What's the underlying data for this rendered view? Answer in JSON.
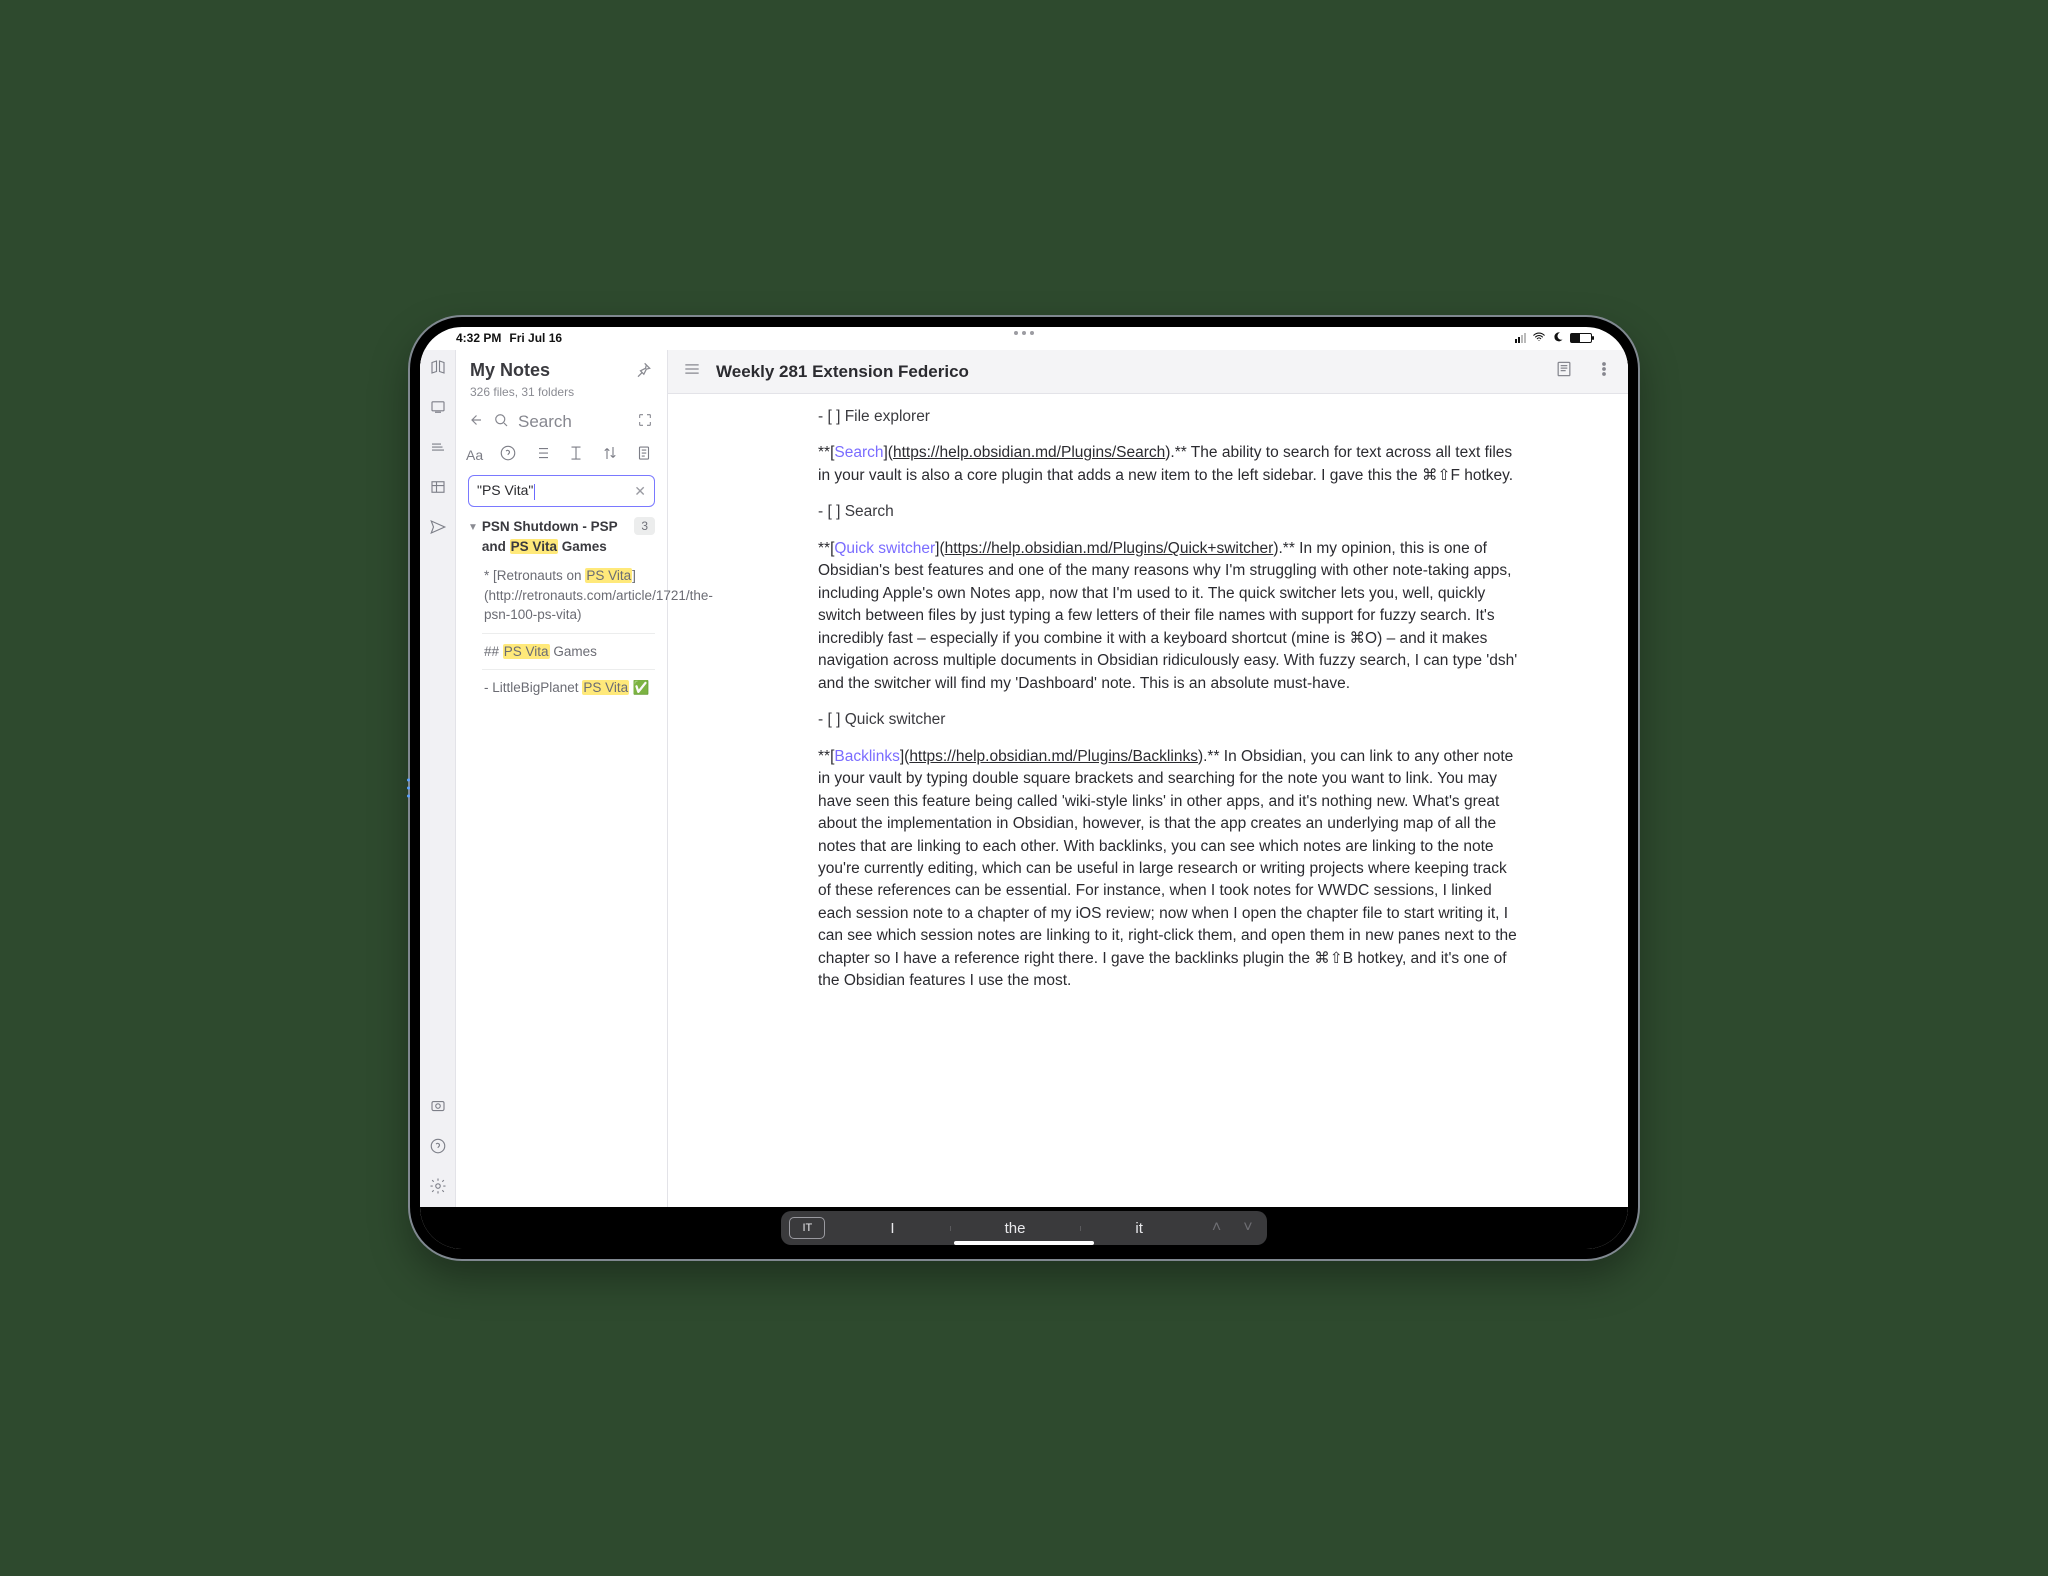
{
  "status": {
    "time": "4:32 PM",
    "date": "Fri Jul 16"
  },
  "sidebar": {
    "vault_title": "My Notes",
    "vault_sub": "326 files, 31 folders",
    "search_label": "Search",
    "toolbar": {
      "aa": "Aa"
    },
    "search_value": "\"PS Vita\"",
    "result": {
      "title_pre": "PSN Shutdown - PSP and ",
      "title_hl": "PS Vita",
      "title_post": " Games",
      "count": "3",
      "items": [
        {
          "pre": "* [Retronauts on ",
          "hl": "PS Vita",
          "post": "](http://retronauts.com/article/1721/the-psn-100-ps-vita)"
        },
        {
          "pre": "## ",
          "hl": "PS Vita",
          "post": " Games"
        },
        {
          "pre": "- LittleBigPlanet ",
          "hl": "PS Vita",
          "post": " ✅"
        }
      ]
    }
  },
  "doc": {
    "title": "Weekly 281 Extension Federico",
    "task1": "-  [   ]  File explorer",
    "p_search_a": "**[",
    "p_search_link_text": "Search",
    "p_search_b": "](",
    "p_search_link_url": "https://help.obsidian.md/Plugins/Search",
    "p_search_c": ").** The ability to search for text across all text files in your vault is also a core plugin that adds a new item to the left sidebar. I gave this the ⌘⇧F hotkey.",
    "task2": "-  [   ]  Search",
    "p_qs_a": "**[",
    "p_qs_link_text": "Quick switcher",
    "p_qs_b": "](",
    "p_qs_link_url": "https://help.obsidian.md/Plugins/Quick+switcher",
    "p_qs_c": ").** In my opinion, this is one of Obsidian's best features and one of the many reasons why I'm struggling with other note-taking apps, including Apple's own Notes app, now that I'm used to it. The quick switcher lets you, well, quickly switch between files by just typing a few letters of their file names with support for fuzzy search. It's incredibly fast – especially if you combine it with a keyboard shortcut (mine is ⌘O) – and it makes navigation across multiple documents in Obsidian ridiculously easy. With fuzzy search, I can type 'dsh' and the switcher will find my 'Dashboard' note. This is an absolute must-have.",
    "task3": "-  [   ]  Quick switcher",
    "p_bl_a": "**[",
    "p_bl_link_text": "Backlinks",
    "p_bl_b": "](",
    "p_bl_link_url": "https://help.obsidian.md/Plugins/Backlinks",
    "p_bl_c": ").** In Obsidian, you can link to any other note in your vault by typing double square brackets and searching for the note you want to link. You may have seen this feature being called 'wiki-style links' in other apps, and it's nothing new. What's great about the implementation in Obsidian, however, is that the app creates an underlying map of all the notes that are linking to each other. With backlinks, you can see which notes are linking to the note you're currently editing, which can be useful in large research or writing projects where keeping track of these references can be essential. For instance, when I took notes for WWDC sessions, I linked each session note to a chapter of my iOS review; now when I open the chapter file to start writing it, I can see which session notes are linking to it, right-click them, and open them in new panes next to the chapter so I have a reference right there. I gave the backlinks plugin the ⌘⇧B hotkey, and it's one of the Obsidian features I use the most."
  },
  "keyboard": {
    "lang": "IT",
    "s1": "I",
    "s2": "the",
    "s3": "it"
  }
}
